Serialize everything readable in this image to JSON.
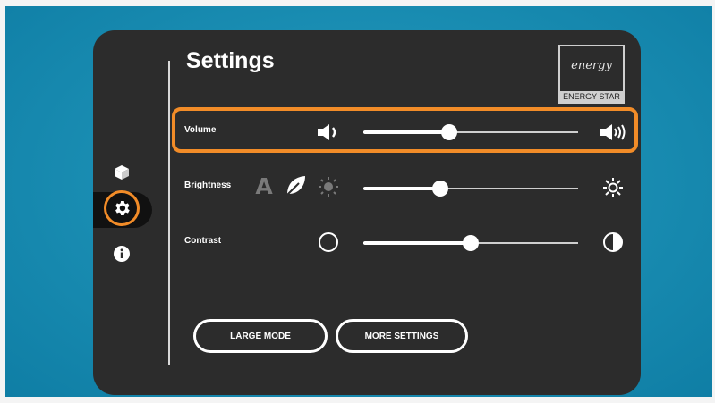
{
  "settings": {
    "title": "Settings",
    "rows": [
      {
        "label": "Volume",
        "value": 0.4
      },
      {
        "label": "Brightness",
        "value": 0.36
      },
      {
        "label": "Contrast",
        "value": 0.5
      }
    ],
    "buttons": {
      "large_mode": "LARGE MODE",
      "more_settings": "MORE SETTINGS"
    },
    "brightness_letter": "A"
  },
  "logo": {
    "text": "energy",
    "caption": "ENERGY STAR"
  },
  "sidebar": {
    "items": [
      "cube-icon",
      "gear-icon",
      "info-icon"
    ],
    "active": "gear-icon"
  },
  "colors": {
    "highlight": "#f28c28",
    "panel": "#2c2c2c",
    "background": "#1b8fb4"
  }
}
